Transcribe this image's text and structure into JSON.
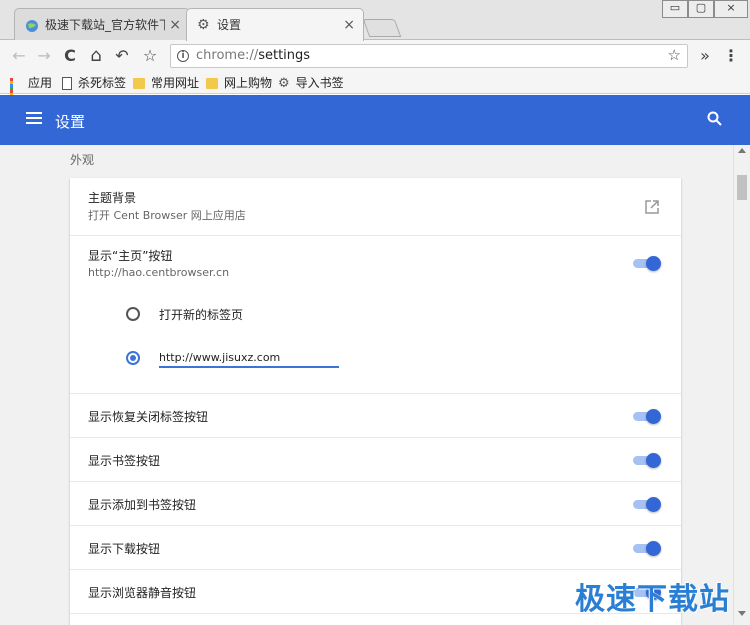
{
  "tabs": [
    {
      "label": "极速下载站_官方软件下载",
      "close": "×",
      "active": false
    },
    {
      "label": "设置",
      "close": "×",
      "active": true
    }
  ],
  "window_controls": {
    "minimize": "▭",
    "maximize": "▢",
    "close": "×"
  },
  "toolbar": {
    "back": "←",
    "forward": "→",
    "reload": "C",
    "home": "⌂",
    "undo": "↶",
    "bookmark": "☆",
    "url_scheme": "chrome://",
    "url_path": "settings",
    "url_star": "☆",
    "extensions": "»",
    "menu": "⋮"
  },
  "bookmarks": [
    {
      "label": "应用",
      "icon": "apps-grid-icon"
    },
    {
      "label": "杀死标签",
      "icon": "page-icon"
    },
    {
      "label": "常用网址",
      "icon": "folder-icon"
    },
    {
      "label": "网上购物",
      "icon": "folder-icon"
    },
    {
      "label": "导入书签",
      "icon": "gear-icon"
    }
  ],
  "header": {
    "title": "设置"
  },
  "section": {
    "label": "外观"
  },
  "appearance": {
    "theme": {
      "title": "主题背景",
      "subtitle": "打开 Cent Browser 网上应用店"
    },
    "home_button": {
      "title": "显示“主页”按钮",
      "subtitle": "http://hao.centbrowser.cn",
      "enabled": true
    },
    "home_options": {
      "new_tab": "打开新的标签页",
      "custom_url": "http://www.jisuxz.com",
      "selected": "custom_url"
    },
    "toggles": [
      {
        "label": "显示恢复关闭标签按钮",
        "enabled": true
      },
      {
        "label": "显示书签按钮",
        "enabled": true
      },
      {
        "label": "显示添加到书签按钮",
        "enabled": true
      },
      {
        "label": "显示下载按钮",
        "enabled": true
      },
      {
        "label": "显示浏览器静音按钮",
        "enabled": true
      }
    ]
  },
  "watermark": "极速下载站",
  "colors": {
    "accent": "#3367d6",
    "toggle_track": "#a6c2f2",
    "watermark": "#2a7fd4"
  }
}
